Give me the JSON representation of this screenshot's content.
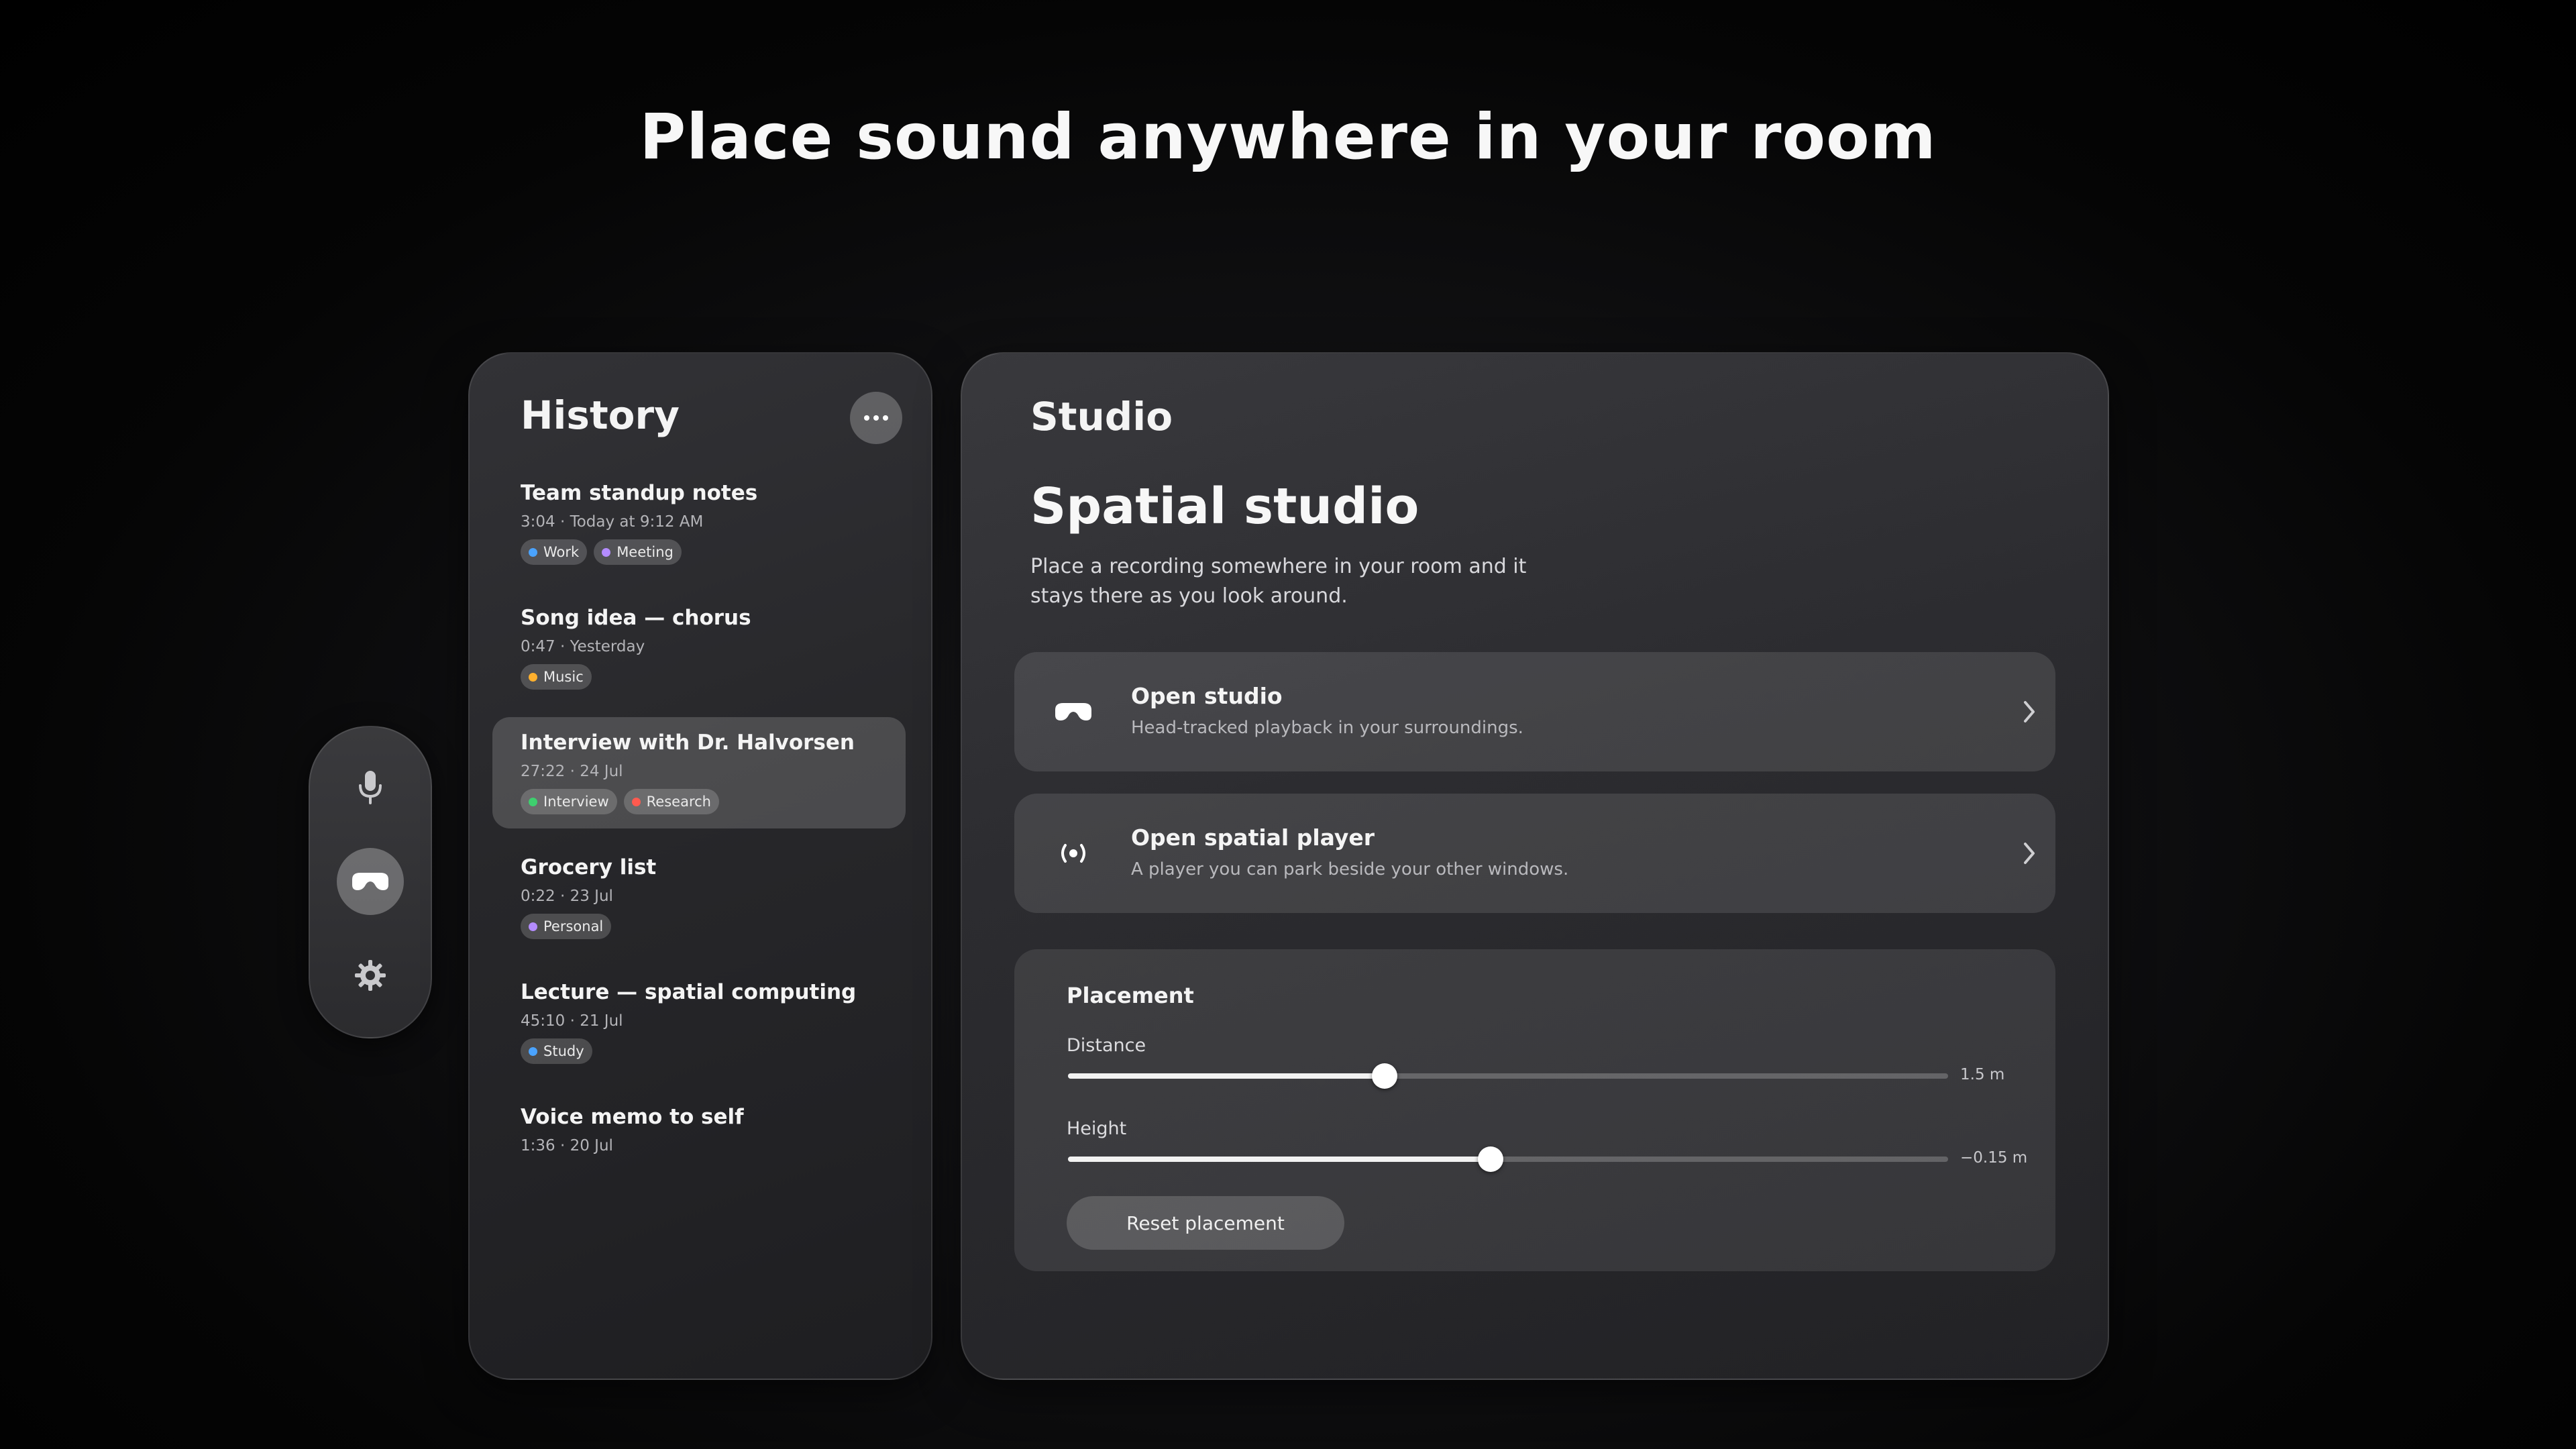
{
  "hero": {
    "title": "Place sound anywhere in your room"
  },
  "ornament": {
    "items": [
      {
        "icon": "microphone-icon",
        "active": false
      },
      {
        "icon": "headset-icon",
        "active": true
      },
      {
        "icon": "gear-icon",
        "active": false
      }
    ]
  },
  "history": {
    "title": "History",
    "more_icon": "more-icon",
    "recordings": [
      {
        "title": "Team standup notes",
        "meta": "3:04 · Today at 9:12 AM",
        "tags": [
          {
            "label": "Work",
            "color": "#4aa3ff"
          },
          {
            "label": "Meeting",
            "color": "#b48cff"
          }
        ]
      },
      {
        "title": "Song idea — chorus",
        "meta": "0:47 · Yesterday",
        "tags": [
          {
            "label": "Music",
            "color": "#ffb02e"
          }
        ]
      },
      {
        "title": "Interview with Dr. Halvorsen",
        "meta": "27:22 · 24 Jul",
        "selected": true,
        "tags": [
          {
            "label": "Interview",
            "color": "#3ecf6e"
          },
          {
            "label": "Research",
            "color": "#ff5a4f"
          }
        ]
      },
      {
        "title": "Grocery list",
        "meta": "0:22 · 23 Jul",
        "tags": [
          {
            "label": "Personal",
            "color": "#b48cff"
          }
        ]
      },
      {
        "title": "Lecture — spatial computing",
        "meta": "45:10 · 21 Jul",
        "tags": [
          {
            "label": "Study",
            "color": "#4aa3ff"
          }
        ]
      },
      {
        "title": "Voice memo to self",
        "meta": "1:36 · 20 Jul",
        "tags": []
      }
    ]
  },
  "studio": {
    "title": "Studio",
    "heading": "Spatial studio",
    "description": "Place a recording somewhere in your room and it stays there as you look around.",
    "actions": [
      {
        "title": "Open studio",
        "subtitle": "Head-tracked playback in your surroundings.",
        "icon": "headset-icon"
      },
      {
        "title": "Open spatial player",
        "subtitle": "A player you can park beside your other windows.",
        "icon": "spatial-audio-icon"
      }
    ],
    "placement": {
      "title": "Placement",
      "distance": {
        "label": "Distance",
        "value": "1.5 m",
        "fraction": 0.36
      },
      "height": {
        "label": "Height",
        "value": "−0.15 m",
        "fraction": 0.48
      },
      "reset_label": "Reset placement"
    }
  }
}
